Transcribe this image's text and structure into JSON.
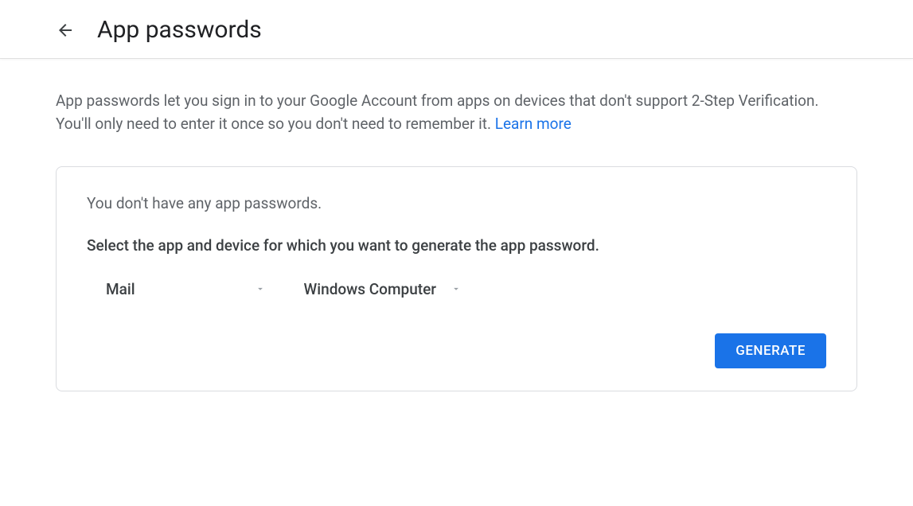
{
  "header": {
    "title": "App passwords"
  },
  "main": {
    "description_text": "App passwords let you sign in to your Google Account from apps on devices that don't support 2-Step Verification. You'll only need to enter it once so you don't need to remember it. ",
    "learn_more_label": "Learn more"
  },
  "card": {
    "empty_state": "You don't have any app passwords.",
    "instruction": "Select the app and device for which you want to generate the app password.",
    "app_select": {
      "selected": "Mail"
    },
    "device_select": {
      "selected": "Windows Computer"
    },
    "generate_label": "GENERATE"
  }
}
